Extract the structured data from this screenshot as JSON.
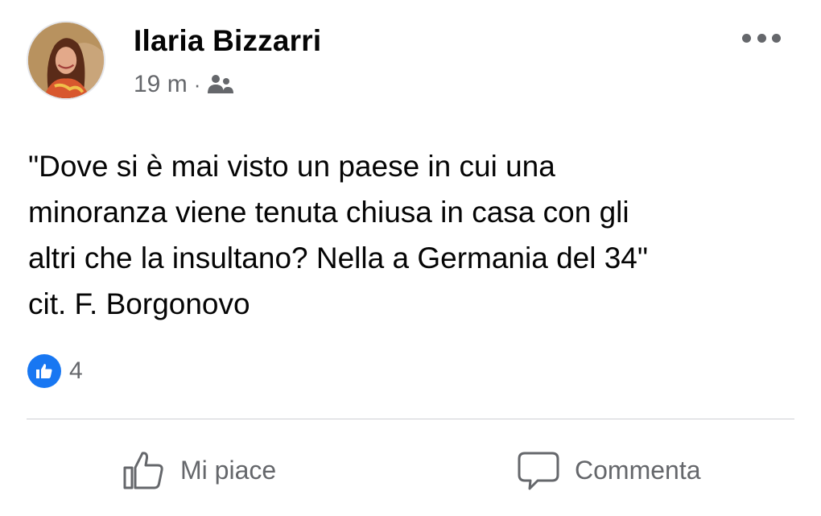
{
  "post": {
    "author": "Ilaria Bizzarri",
    "timestamp": "19 m",
    "separator": "·",
    "audience_icon": "friends-icon",
    "more_icon": "more-options-icon",
    "text_lines": [
      "\"Dove si è mai visto un paese in cui una",
      "minoranza viene tenuta chiusa in casa con gli",
      "altri che la insultano? Nella a Germania del 34\"",
      "cit. F. Borgonovo"
    ],
    "reactions": {
      "icon": "like-reaction-icon",
      "count": "4"
    }
  },
  "actions": {
    "like_label": "Mi piace",
    "like_icon": "thumbs-up-outline-icon",
    "comment_label": "Commenta",
    "comment_icon": "comment-bubble-icon"
  },
  "colors": {
    "accent": "#1877f2",
    "secondary_text": "#65676b",
    "primary_text": "#050505",
    "divider": "#ced0d4"
  }
}
